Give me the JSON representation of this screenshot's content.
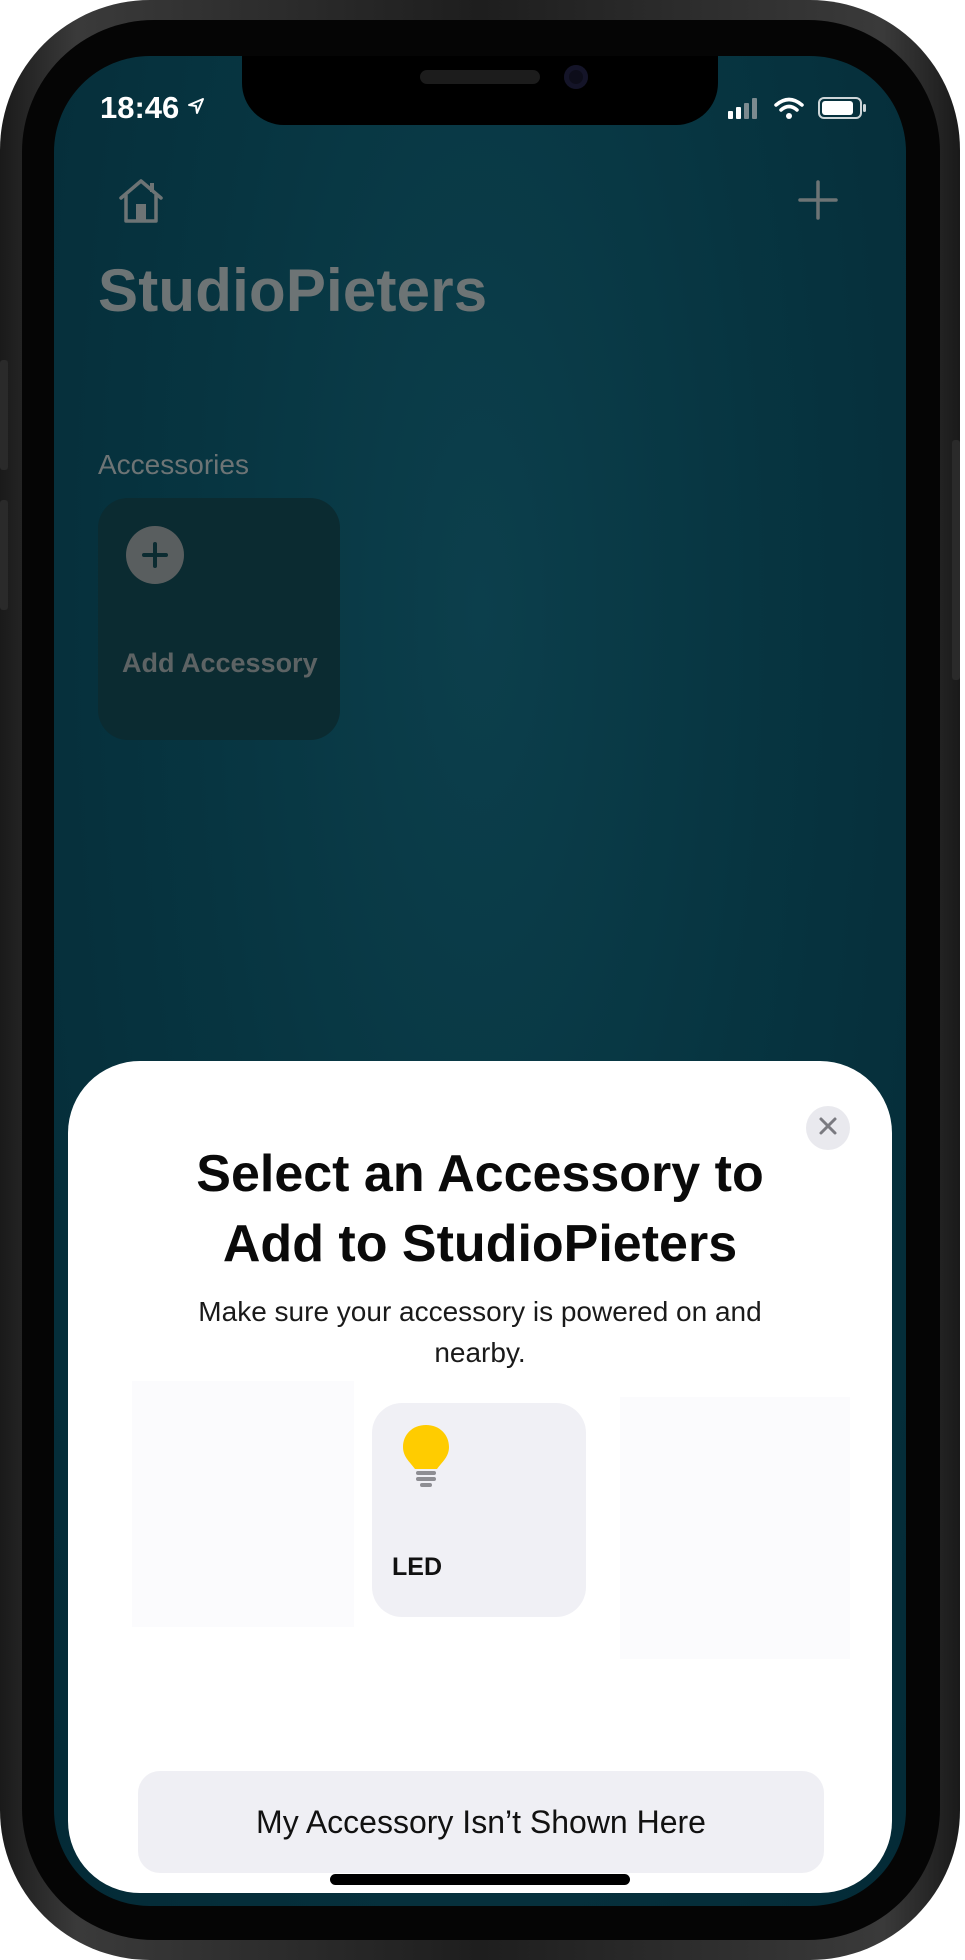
{
  "status_bar": {
    "time": "18:46",
    "location_icon": "location-arrow-icon",
    "signal_icon": "cellular-signal-icon",
    "wifi_icon": "wifi-icon",
    "battery_icon": "battery-icon"
  },
  "home_screen": {
    "home_icon": "house-icon",
    "add_icon": "plus-icon",
    "title": "StudioPieters",
    "section_label": "Accessories",
    "add_tile_label": "Add Accessory"
  },
  "sheet": {
    "close_icon": "close-icon",
    "title": "Select an Accessory to Add to StudioPieters",
    "subtitle": "Make sure your accessory is powered on and nearby.",
    "accessories": [
      {
        "label": "LED",
        "icon": "lightbulb-icon",
        "icon_color": "#FFCC00"
      }
    ],
    "not_shown_button": "My Accessory Isn’t Shown Here"
  },
  "colors": {
    "background_teal": "#073541",
    "dimmed_text": "#6D7475",
    "sheet_background": "#FFFFFF",
    "tile_background": "#F0F0F5",
    "bulb_yellow": "#FFCC00"
  }
}
